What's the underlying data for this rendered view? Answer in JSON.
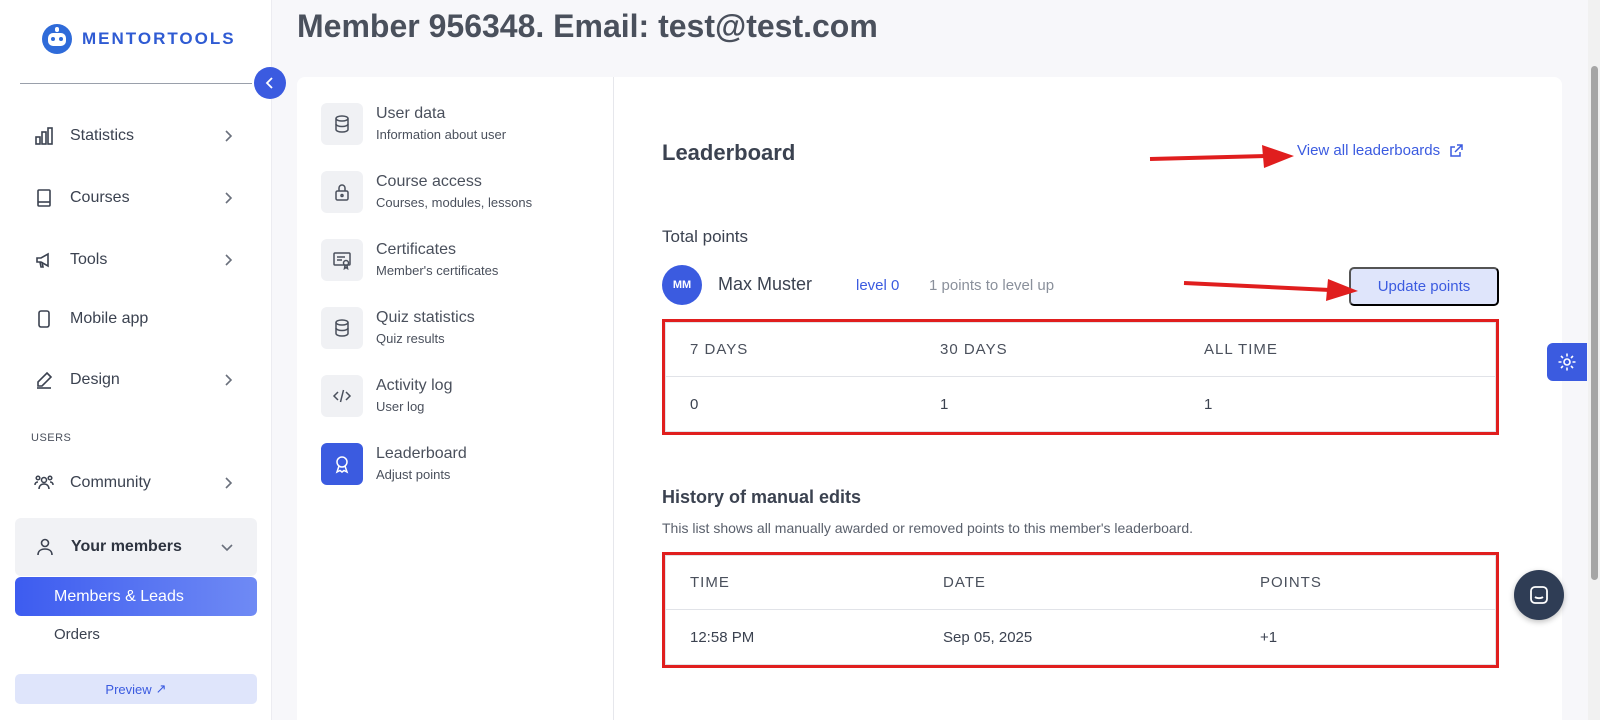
{
  "brand": {
    "name": "MENTORTOOLS"
  },
  "sidebar": {
    "items": [
      {
        "label": "Statistics",
        "icon": "bar-chart-icon"
      },
      {
        "label": "Courses",
        "icon": "book-icon"
      },
      {
        "label": "Tools",
        "icon": "megaphone-icon"
      },
      {
        "label": "Mobile app",
        "icon": "phone-icon"
      },
      {
        "label": "Design",
        "icon": "pencil-icon"
      }
    ],
    "section_users": "USERS",
    "community": "Community",
    "your_members": "Your members",
    "members_leads": "Members & Leads",
    "orders": "Orders",
    "preview": "Preview"
  },
  "header": {
    "title": "Member 956348. Email: test@test.com"
  },
  "subnav": [
    {
      "title": "User data",
      "sub": "Information about user",
      "icon": "database-icon"
    },
    {
      "title": "Course access",
      "sub": "Courses, modules, lessons",
      "icon": "lock-icon"
    },
    {
      "title": "Certificates",
      "sub": "Member's certificates",
      "icon": "certificate-icon"
    },
    {
      "title": "Quiz statistics",
      "sub": "Quiz results",
      "icon": "database-icon"
    },
    {
      "title": "Activity log",
      "sub": "User log",
      "icon": "code-icon"
    },
    {
      "title": "Leaderboard",
      "sub": "Adjust points",
      "icon": "award-icon"
    }
  ],
  "leaderboard": {
    "title": "Leaderboard",
    "view_all": "View all leaderboards",
    "total_points": "Total points",
    "avatar_initials": "MM",
    "user_name": "Max Muster",
    "level": "level 0",
    "to_level_up": "1 points to level up",
    "update_button": "Update points",
    "points_table": {
      "headers": [
        "7 DAYS",
        "30 DAYS",
        "ALL TIME"
      ],
      "values": [
        "0",
        "1",
        "1"
      ]
    },
    "history_title": "History of manual edits",
    "history_desc": "This list shows all manually awarded or removed points to this member's leaderboard.",
    "history_table": {
      "headers": [
        "TIME",
        "DATE",
        "POINTS"
      ],
      "rows": [
        [
          "12:58 PM",
          "Sep 05, 2025",
          "+1"
        ]
      ]
    }
  },
  "colors": {
    "accent": "#3b5be0",
    "highlight": "#e01e1e"
  }
}
